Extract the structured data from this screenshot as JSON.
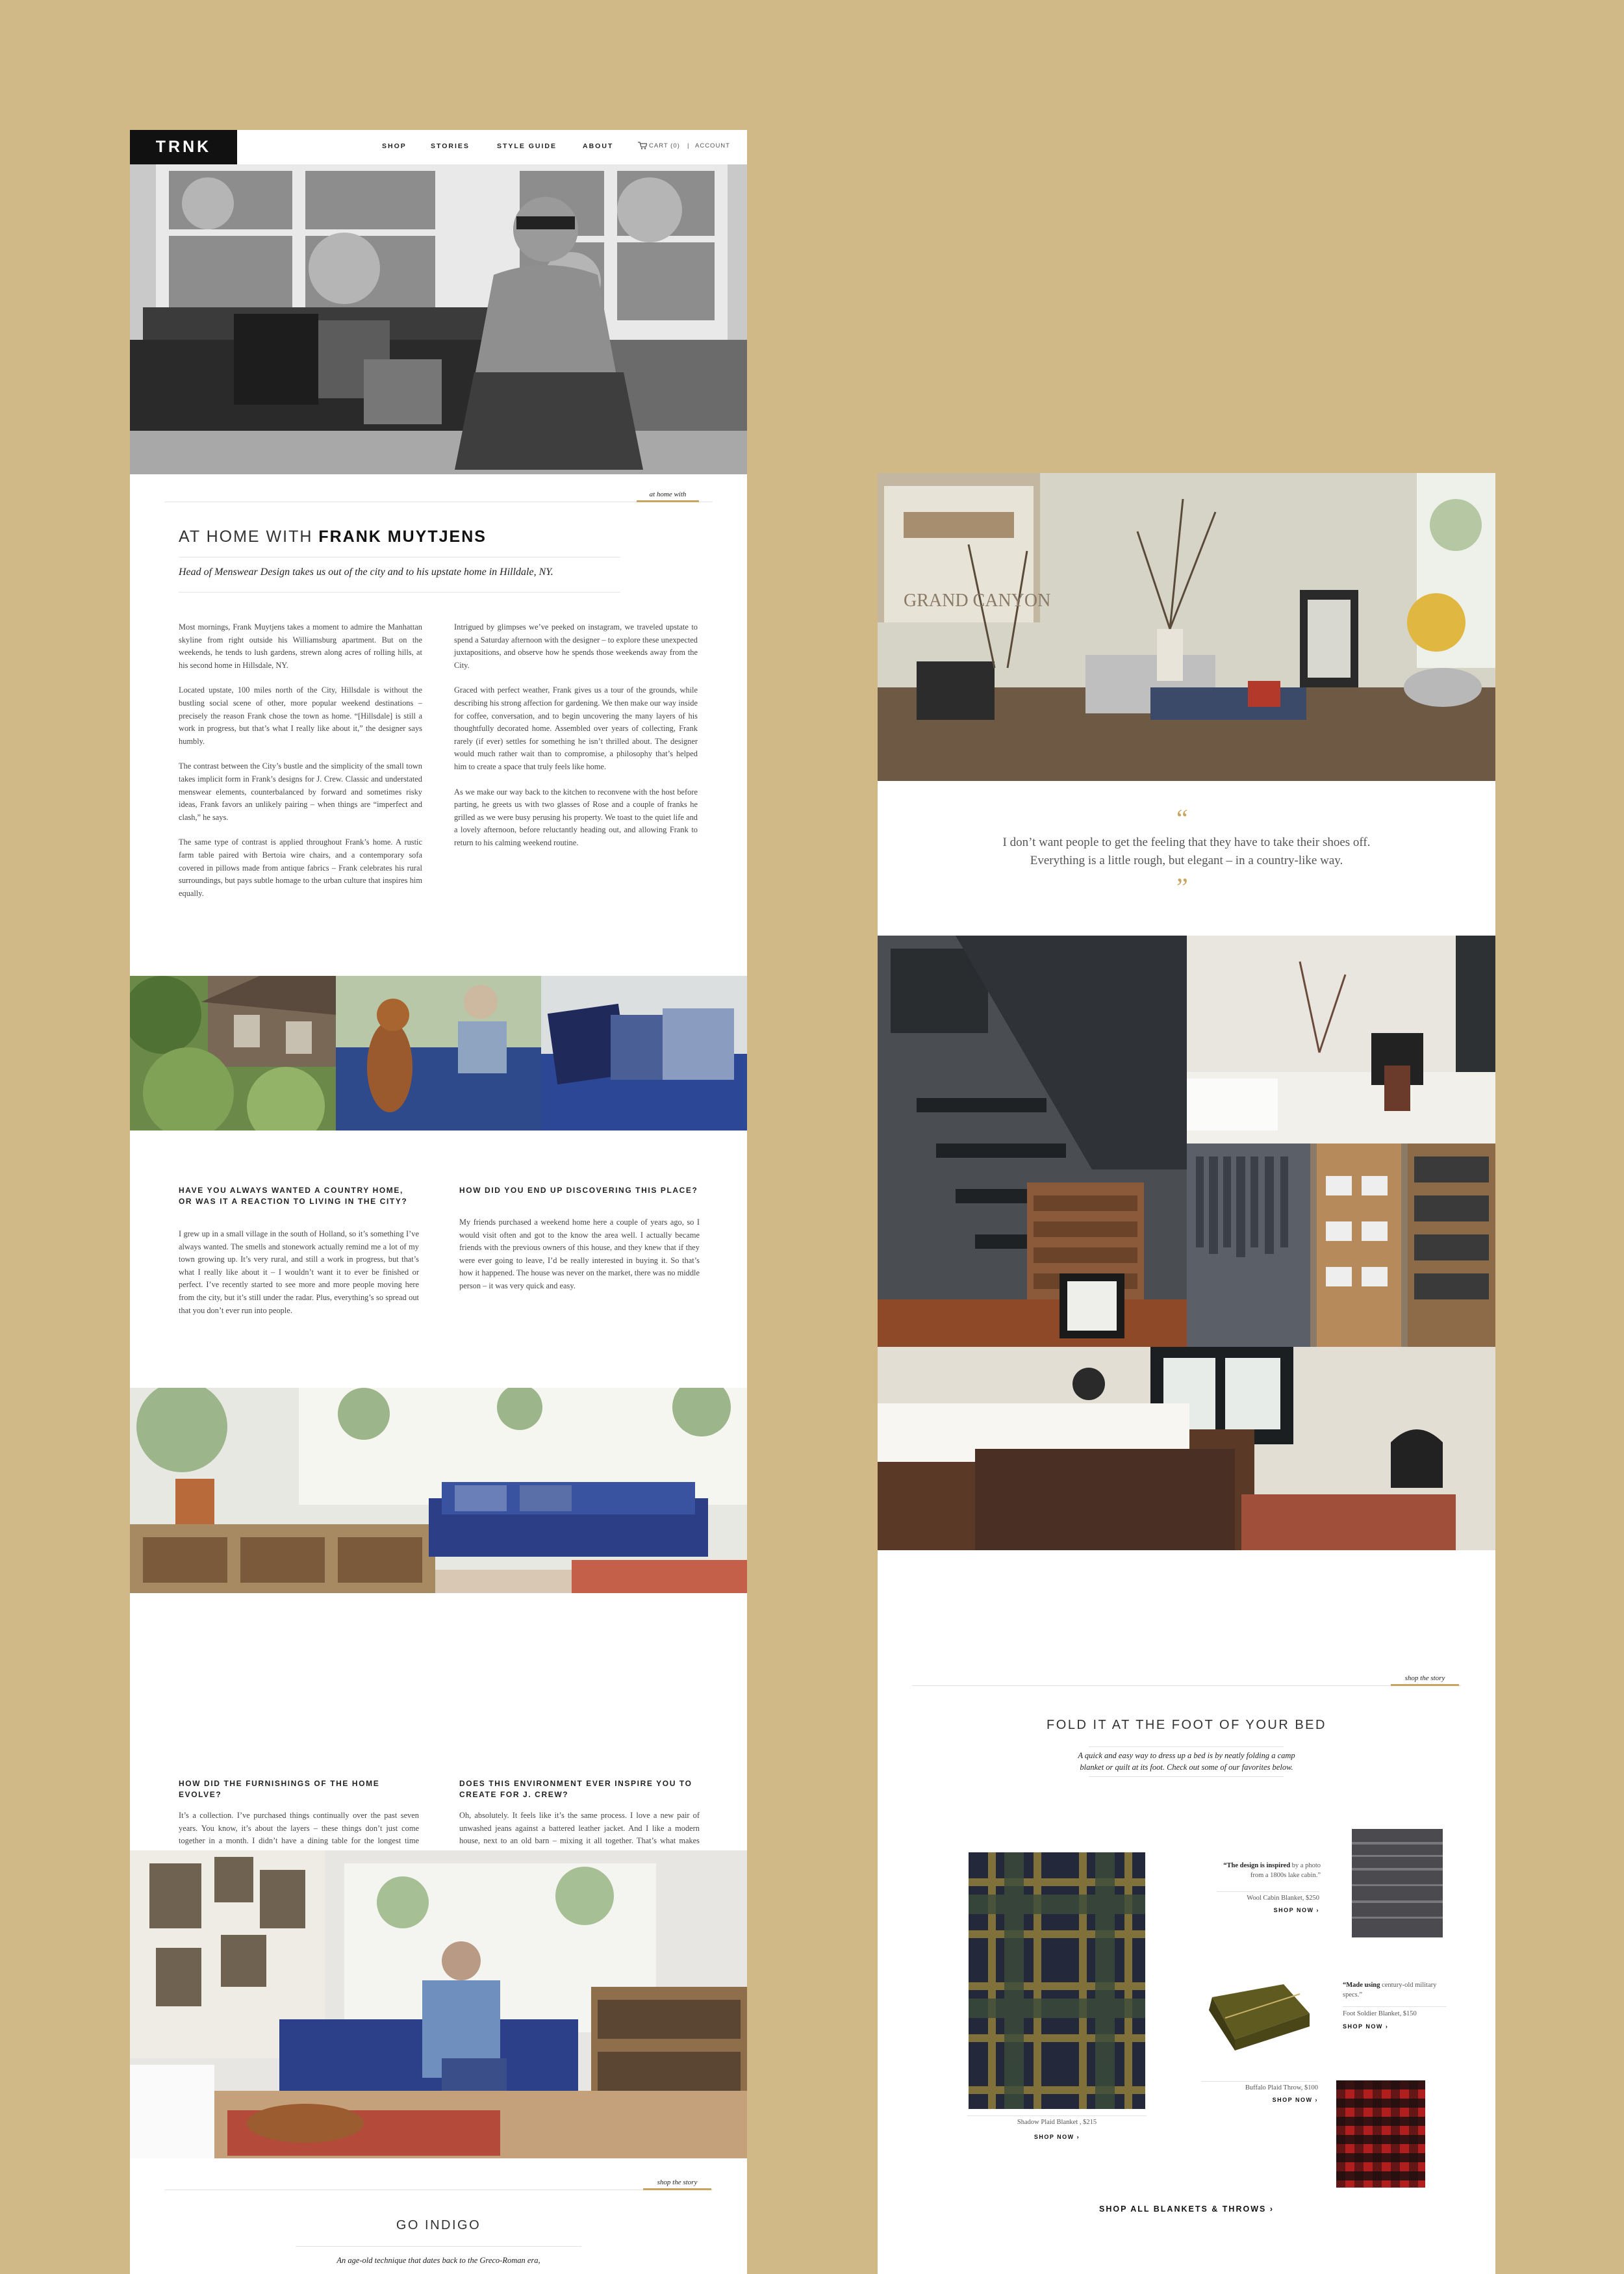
{
  "nav": {
    "logo": "TRNK",
    "items": [
      "SHOP",
      "STORIES",
      "STYLE GUIDE",
      "ABOUT"
    ],
    "cart": "CART (0)",
    "separator": "|",
    "account": "ACCOUNT"
  },
  "article": {
    "tag": "at home with",
    "title_prefix": "AT HOME WITH",
    "title_name": "FRANK MUYTJENS",
    "subtitle": "Head of Menswear Design takes us out of the city and to his upstate home in Hilldale, NY.",
    "left_paragraphs": [
      "Most mornings, Frank Muytjens takes a moment to admire the Manhattan skyline from right outside his Williamsburg apartment. But on the weekends, he tends to lush gardens, strewn along acres of rolling hills, at his second home in Hillsdale, NY.",
      "Located upstate, 100 miles north of the City, Hillsdale is without the bustling social scene of other, more popular weekend destinations – precisely the reason Frank chose the town as home. “[Hillsdale] is still a work in progress, but that’s what I really like about it,” the designer says humbly.",
      "The contrast between the City’s bustle and the simplicity of the small town takes implicit form in Frank’s designs for J. Crew. Classic and understated menswear elements, counterbalanced by forward and sometimes risky ideas, Frank favors an unlikely pairing – when things are “imperfect and clash,” he says.",
      "The same type of contrast is applied throughout Frank’s home. A rustic farm table paired with Bertoia wire chairs, and a contemporary sofa covered in pillows made from antique fabrics – Frank celebrates his rural surroundings, but pays subtle homage to the urban culture that inspires him equally."
    ],
    "right_paragraphs": [
      "Intrigued by glimpses we’ve peeked on instagram, we traveled upstate to spend a Saturday afternoon with the designer – to explore these unexpected juxtapositions, and observe how he spends those weekends away from the City.",
      "Graced with perfect weather, Frank gives us a tour of the grounds, while describing his strong affection for gardening. We then make our way inside for coffee, conversation, and to begin uncovering the many layers of his thoughtfully decorated home. Assembled over years of collecting, Frank rarely (if ever) settles for something he isn’t thrilled about. The designer would much rather wait than to compromise, a philosophy that’s helped him to create a space that truly feels like home.",
      "As we make our way back to the kitchen to reconvene with the host before parting, he greets us with two glasses of Rose and a couple of franks he grilled as we were busy perusing his property. We toast to the quiet life and a lovely afternoon, before reluctantly heading out, and allowing Frank to return to his calming weekend routine."
    ]
  },
  "qa": [
    {
      "q": "HAVE YOU ALWAYS WANTED A COUNTRY HOME, OR WAS IT A REACTION TO LIVING IN THE CITY?",
      "a": "I grew up in a small village in the south of Holland, so it’s something I’ve always wanted. The smells and stonework actually remind me a lot of my town growing up. It’s very rural, and still a work in progress, but that’s what I really like about it – I wouldn’t want it to ever be finished or perfect. I’ve recently started to see more and more people moving here from the city, but it’s still under the radar. Plus, everything’s so spread out that you don’t ever run into people."
    },
    {
      "q": "HOW DID YOU END UP DISCOVERING THIS PLACE?",
      "a": "My friends purchased a weekend home here a couple of years ago, so I would visit often and got to the know the area well. I actually became friends with the previous owners of this house, and they knew that if they were ever going to leave, I’d be really interested in buying it. So that’s how it happened. The house was never on the market, there was no middle person – it was very quick and easy."
    },
    {
      "q": "HOW DID THE FURNISHINGS OF THE HOME EVOLVE?",
      "a": "It’s a collection. I’ve purchased things continually over the past seven years. You know, it’s about the layers – these things don’t just come together in a month. I didn’t have a dining table for the longest time because I just couldn’t find the right one. After a year and a half, I finally found one in a vintage store around here, and that was it. The process is similar to how I design the line for J Crew. It’s emotional and very personal – it’s hard to explain how it all happens. I know that I need it when I see it."
    },
    {
      "q": "DOES THIS ENVIRONMENT EVER INSPIRE YOU TO CREATE FOR J. CREW?",
      "a": "Oh, absolutely. It feels like it’s the same process. I love a new pair of unwashed jeans against a battered leather jacket. And I like a modern house, next to an old barn – mixing it all together. That’s what makes things interesting, and that’s how we put stuff together at J Crew. It’s inspiring to have the NYC skyline during the week, and the country on the weekends – it’s the best of both worlds."
    }
  ],
  "go_indigo": {
    "tag": "shop the story",
    "title": "GO INDIGO",
    "desc": "An age-old technique that dates back to the Greco-Roman era,"
  },
  "quote": {
    "open": "“",
    "close": "”",
    "line1": "I don’t want people to get the feeling that they have to take their shoes off.",
    "line2": "Everything is a little rough, but elegant – in a country-like way."
  },
  "poster_text": "GRAND CANYON",
  "shop_story": {
    "tag": "shop the story",
    "title": "FOLD IT AT THE FOOT OF YOUR BED",
    "desc_line1": "A quick and easy way to dress up a bed is by neatly folding a camp",
    "desc_line2": "blanket or quilt at its foot. Check out some of our favorites below.",
    "products": [
      {
        "name": "Shadow Plaid Blanket , $215",
        "cta": "SHOP NOW ›"
      },
      {
        "quote_bold": "“The design is inspired",
        "quote_rest": "by a photo from a 1800s lake cabin.”",
        "name": "Wool Cabin Blanket, $250",
        "cta": "SHOP NOW ›"
      },
      {
        "name": "Buffalo Plaid Throw, $100",
        "cta": "SHOP NOW ›"
      },
      {
        "quote_bold": "“Made using",
        "quote_rest": "century-old military specs.”",
        "name": "Foot Soldier Blanket, $150",
        "cta": "SHOP NOW ›"
      }
    ],
    "shop_all": "SHOP ALL BLANKETS & THROWS ›"
  },
  "colors": {
    "background": "#d0b887",
    "accent_gold": "#c9a45e",
    "logo_bg": "#111111"
  },
  "icons": [
    "cart-icon",
    "quote-open-icon",
    "quote-close-icon"
  ]
}
